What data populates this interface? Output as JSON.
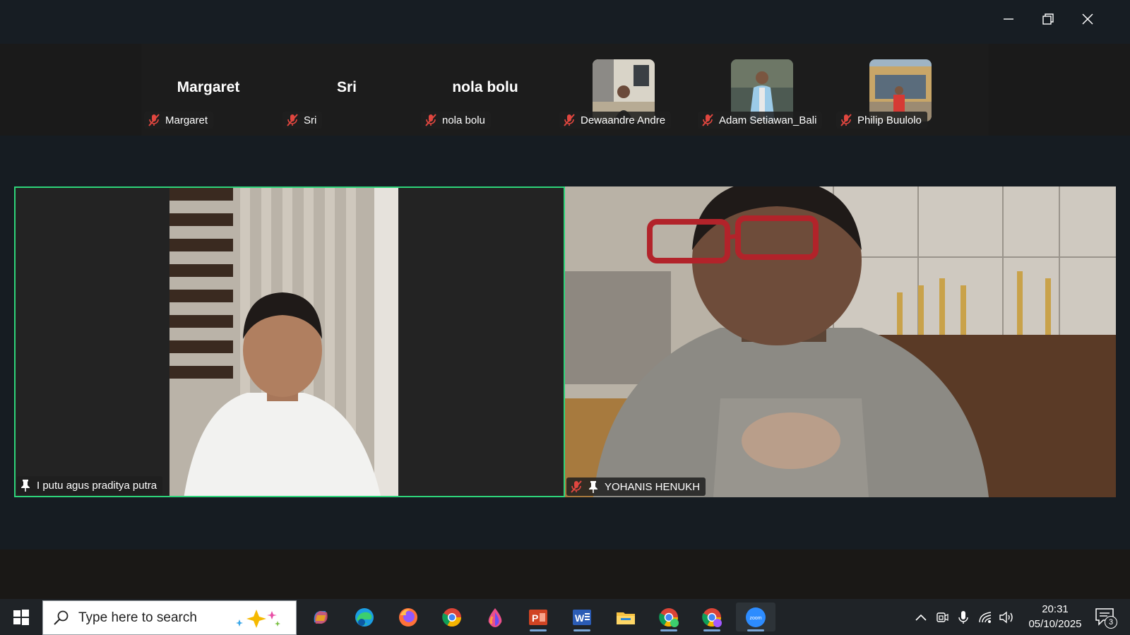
{
  "window": {
    "controls": [
      "minimize",
      "restore",
      "close"
    ]
  },
  "gallery": {
    "participants": [
      {
        "display_big": "Margaret",
        "name": "Margaret",
        "muted": true,
        "has_video": false
      },
      {
        "display_big": "Sri",
        "name": "Sri",
        "muted": true,
        "has_video": false
      },
      {
        "display_big": "nola bolu",
        "name": "nola bolu",
        "muted": true,
        "has_video": false
      },
      {
        "display_big": "",
        "name": "Dewaandre Andre",
        "muted": true,
        "has_video": true
      },
      {
        "display_big": "",
        "name": "Adam Setiawan_Bali",
        "muted": true,
        "has_video": true
      },
      {
        "display_big": "",
        "name": "Philip Buulolo",
        "muted": true,
        "has_video": true
      }
    ]
  },
  "stage": {
    "left": {
      "name": "I putu agus praditya putra",
      "pinned": true,
      "muted": false,
      "active_speaker": true
    },
    "right": {
      "name": "YOHANIS HENUKH",
      "pinned": true,
      "muted": true,
      "active_speaker": false
    }
  },
  "taskbar": {
    "search_placeholder": "Type here to search",
    "apps": [
      "copilot",
      "edge",
      "firefox",
      "chrome",
      "app-drop",
      "powerpoint",
      "word",
      "file-explorer",
      "chrome-profile-a",
      "chrome-profile-b",
      "zoom"
    ],
    "active_app": "zoom",
    "time": "20:31",
    "date": "05/10/2025",
    "notification_count": "3"
  },
  "colors": {
    "active_speaker_border": "#2ed47a",
    "mute_icon": "#e0463f",
    "taskbar_bg": "#1f2327"
  }
}
